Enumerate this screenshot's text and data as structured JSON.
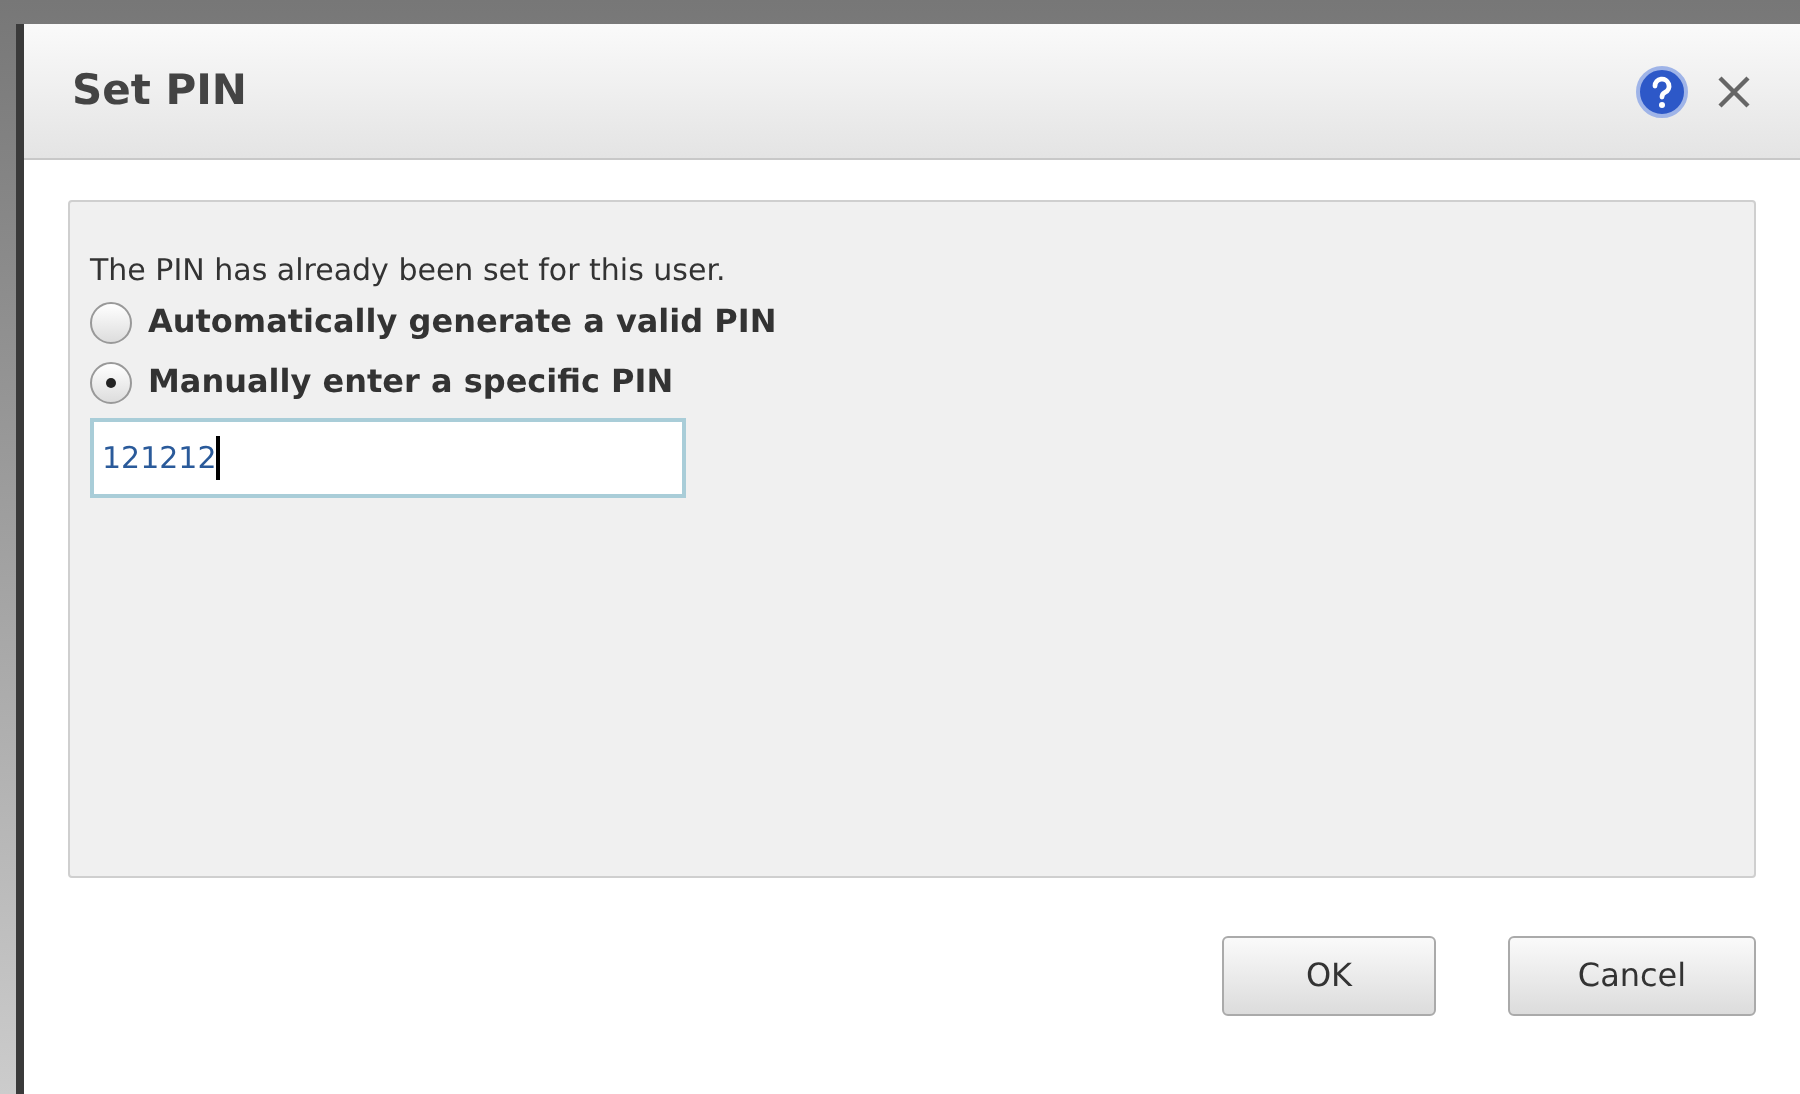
{
  "dialog": {
    "title": "Set PIN",
    "message": "The PIN has already been set for this user.",
    "options": [
      {
        "label": "Automatically generate a valid PIN",
        "selected": false
      },
      {
        "label": "Manually enter a specific PIN",
        "selected": true
      }
    ],
    "pin_field": {
      "value": "121212"
    },
    "buttons": [
      {
        "label": "OK"
      },
      {
        "label": "Cancel"
      }
    ]
  }
}
